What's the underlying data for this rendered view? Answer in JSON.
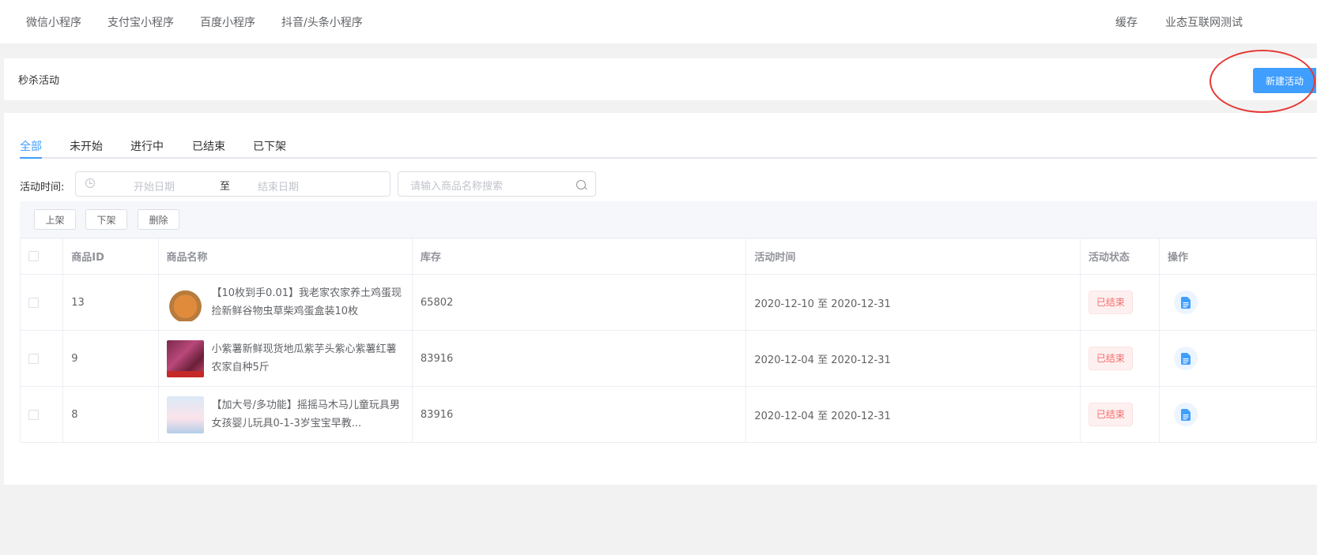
{
  "topnav": {
    "items": [
      "微信小程序",
      "支付宝小程序",
      "百度小程序",
      "抖音/头条小程序"
    ],
    "right_items": [
      "缓存",
      "业态互联网测试"
    ]
  },
  "header": {
    "title": "秒杀活动",
    "new_button": "新建活动"
  },
  "tabs": [
    "全部",
    "未开始",
    "进行中",
    "已结束",
    "已下架"
  ],
  "active_tab": "全部",
  "filter": {
    "label": "活动时间:",
    "start_placeholder": "开始日期",
    "separator": "至",
    "end_placeholder": "结束日期",
    "search_placeholder": "请输入商品名称搜索"
  },
  "toolbar": {
    "buttons": [
      "上架",
      "下架",
      "删除"
    ]
  },
  "table": {
    "columns": [
      "商品ID",
      "商品名称",
      "库存",
      "活动时间",
      "活动状态",
      "操作"
    ],
    "rows": [
      {
        "id": "13",
        "name": "【10枚到手0.01】我老家农家养土鸡蛋现捡新鲜谷物虫草柴鸡蛋盒装10枚",
        "stock": "65802",
        "time": "2020-12-10 至 2020-12-31",
        "status": "已结束",
        "thumb": "eggs"
      },
      {
        "id": "9",
        "name": "小紫薯新鲜现货地瓜紫芋头紫心紫薯红薯农家自种5斤",
        "stock": "83916",
        "time": "2020-12-04 至 2020-12-31",
        "status": "已结束",
        "thumb": "potato"
      },
      {
        "id": "8",
        "name": "【加大号/多功能】摇摇马木马儿童玩具男女孩婴儿玩具0-1-3岁宝宝早教...",
        "stock": "83916",
        "time": "2020-12-04 至 2020-12-31",
        "status": "已结束",
        "thumb": "horse"
      }
    ]
  },
  "colors": {
    "primary": "#409eff",
    "danger": "#f56c6c",
    "annotation": "#e53935"
  }
}
